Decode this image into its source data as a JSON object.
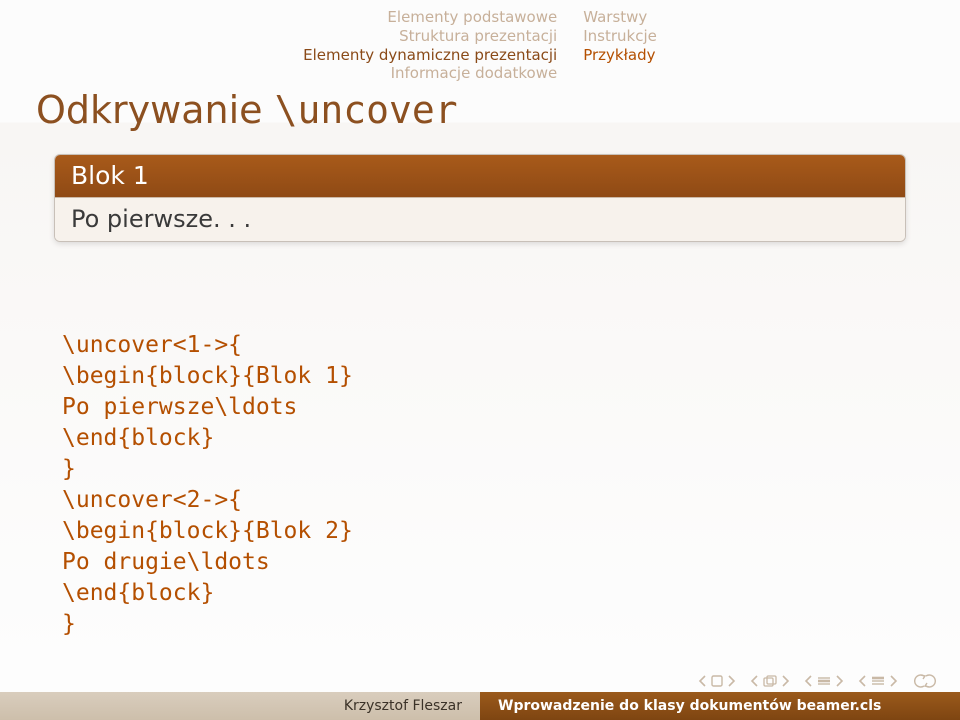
{
  "topnav": {
    "left": [
      "Elementy podstawowe",
      "Struktura prezentacji",
      "Elementy dynamiczne prezentacji",
      "Informacje dodatkowe"
    ],
    "left_active_index": 2,
    "right": [
      "Warstwy",
      "Instrukcje",
      "Przykłady"
    ],
    "right_active_index": 2
  },
  "frametitle": {
    "text": "Odkrywanie ",
    "cmd": "\\uncover"
  },
  "block": {
    "title": "Blok 1",
    "body": "Po pierwsze. . ."
  },
  "code": "\\uncover<1->{\n\\begin{block}{Blok 1}\nPo pierwsze\\ldots\n\\end{block}\n}\n\\uncover<2->{\n\\begin{block}{Blok 2}\nPo drugie\\ldots\n\\end{block}\n}",
  "footer": {
    "author": "Krzysztof Fleszar",
    "title": "Wprowadzenie do klasy dokumentów beamer.cls"
  },
  "colors": {
    "accent": "#8f4a15",
    "code": "#b44f00",
    "muted": "#c7b09a"
  }
}
